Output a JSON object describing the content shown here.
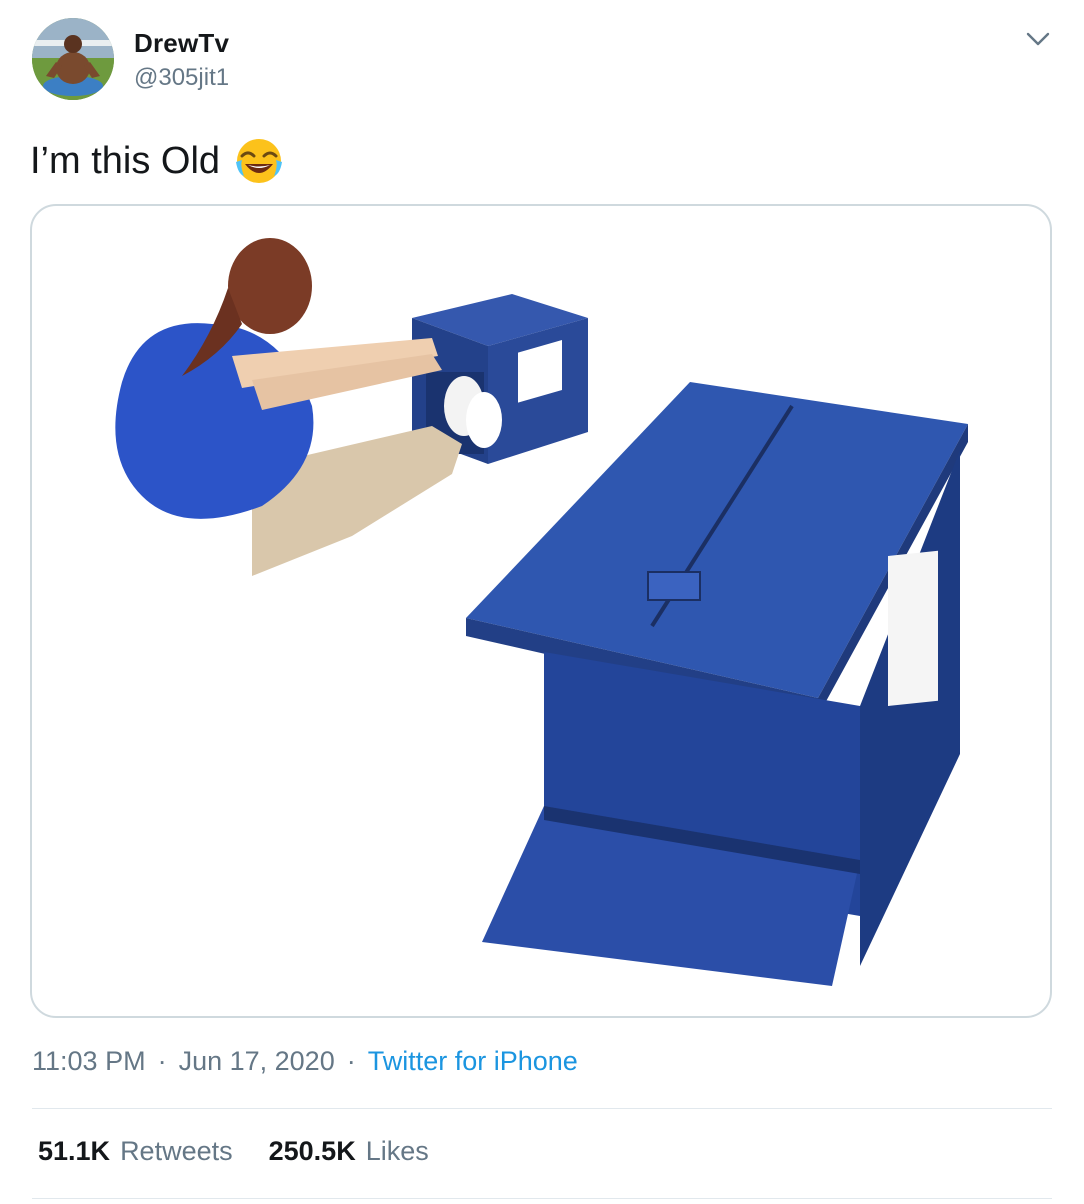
{
  "user": {
    "display_name": "DrewTv",
    "handle": "@305jit1"
  },
  "tweet": {
    "text": "I’m this Old",
    "emoji_icon": "face-with-tears-of-joy-icon"
  },
  "meta": {
    "time": "11:03 PM",
    "date": "Jun 17, 2020",
    "source": "Twitter for iPhone",
    "separator": "·"
  },
  "stats": {
    "retweets_count": "51.1K",
    "retweets_label": "Retweets",
    "likes_count": "250.5K",
    "likes_label": "Likes"
  },
  "colors": {
    "link": "#1b95e0",
    "muted": "#657786",
    "box_blue": "#2b4ea0"
  }
}
